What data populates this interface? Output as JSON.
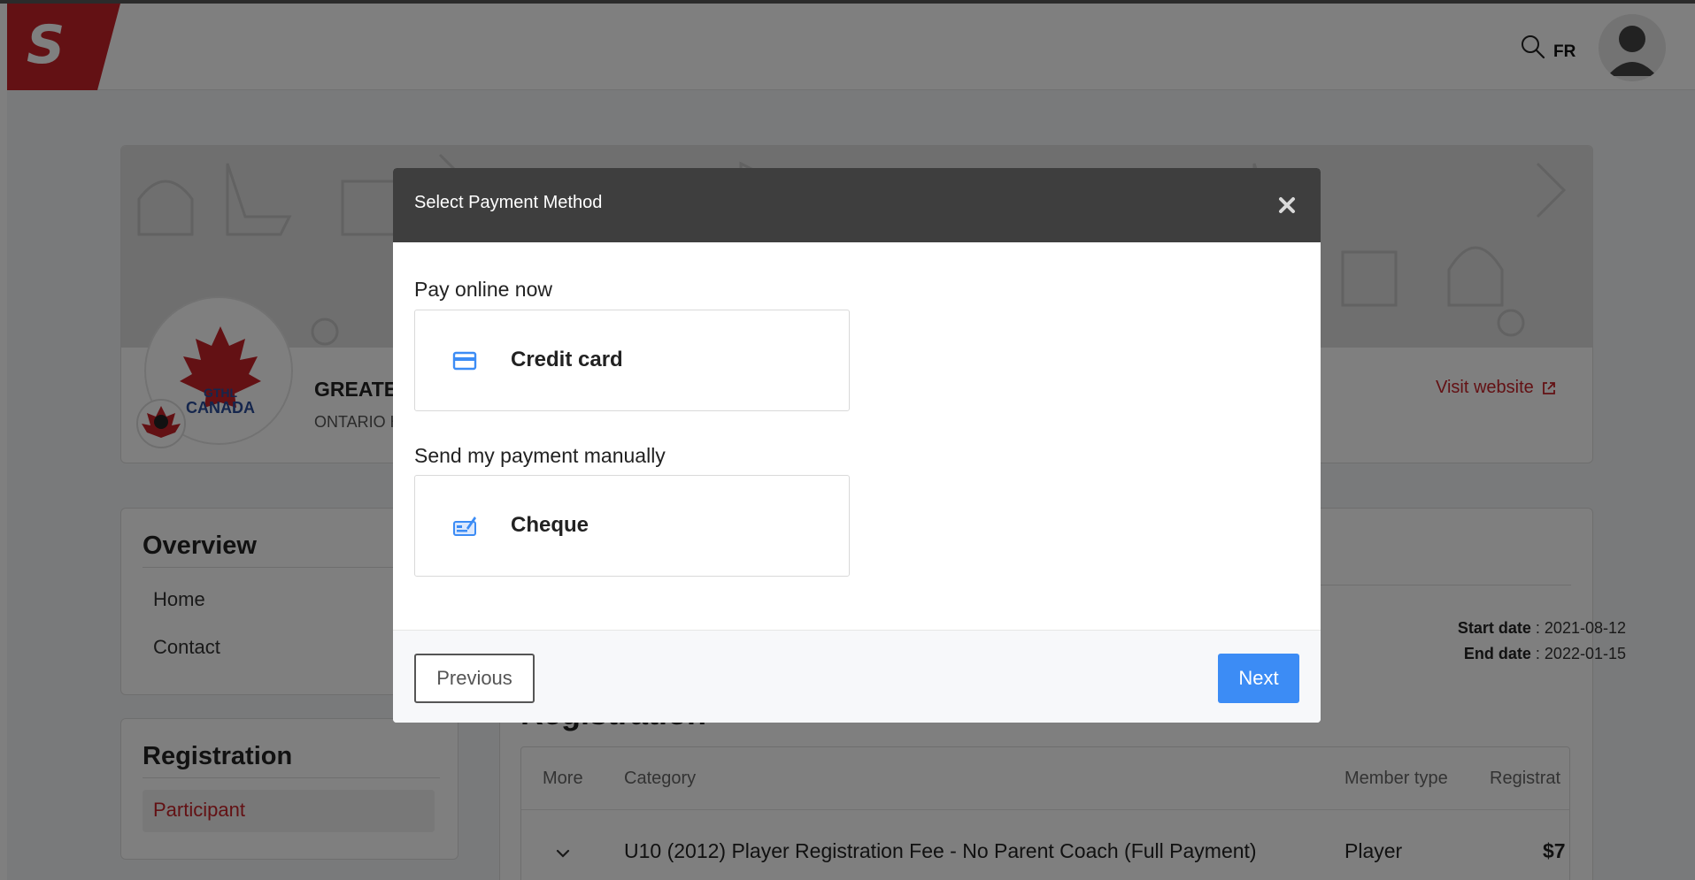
{
  "header": {
    "logo_letter": "S",
    "lang_label": "FR"
  },
  "org": {
    "name": "GREATE",
    "subtitle": "ONTARIO H",
    "visit_label": "Visit website",
    "logo_text_top": "GTHL",
    "logo_text_bottom": "CANADA"
  },
  "sidebar": {
    "overview_title": "Overview",
    "overview_items": [
      "Home",
      "Contact"
    ],
    "registration_title": "Registration",
    "registration_items": [
      "Participant"
    ]
  },
  "event": {
    "start_label": "Start date",
    "start_value": "2021-08-12",
    "end_label": "End date",
    "end_value": "2022-01-15",
    "registration_heading": "Registration"
  },
  "table": {
    "columns": [
      "More",
      "Category",
      "Member type",
      "Registrat"
    ],
    "rows": [
      {
        "category": "U10 (2012) Player Registration Fee - No Parent Coach (Full Payment)",
        "member_type": "Player",
        "price": "$7"
      }
    ]
  },
  "modal": {
    "title": "Select Payment Method",
    "online_label": "Pay online now",
    "credit_card_label": "Credit card",
    "manual_label": "Send my payment manually",
    "cheque_label": "Cheque",
    "previous_label": "Previous",
    "next_label": "Next"
  },
  "colors": {
    "brand": "#c62229",
    "primary_button": "#3c8cf5",
    "modal_header": "#3e3e3e",
    "icon_blue": "#3c8cf5"
  },
  "icons": {
    "search": "search-icon",
    "close": "close-icon",
    "credit_card": "credit-card-icon",
    "cheque": "cheque-icon",
    "external": "external-link-icon",
    "avatar": "user-avatar-icon",
    "chevron": "chevron-down-icon"
  }
}
